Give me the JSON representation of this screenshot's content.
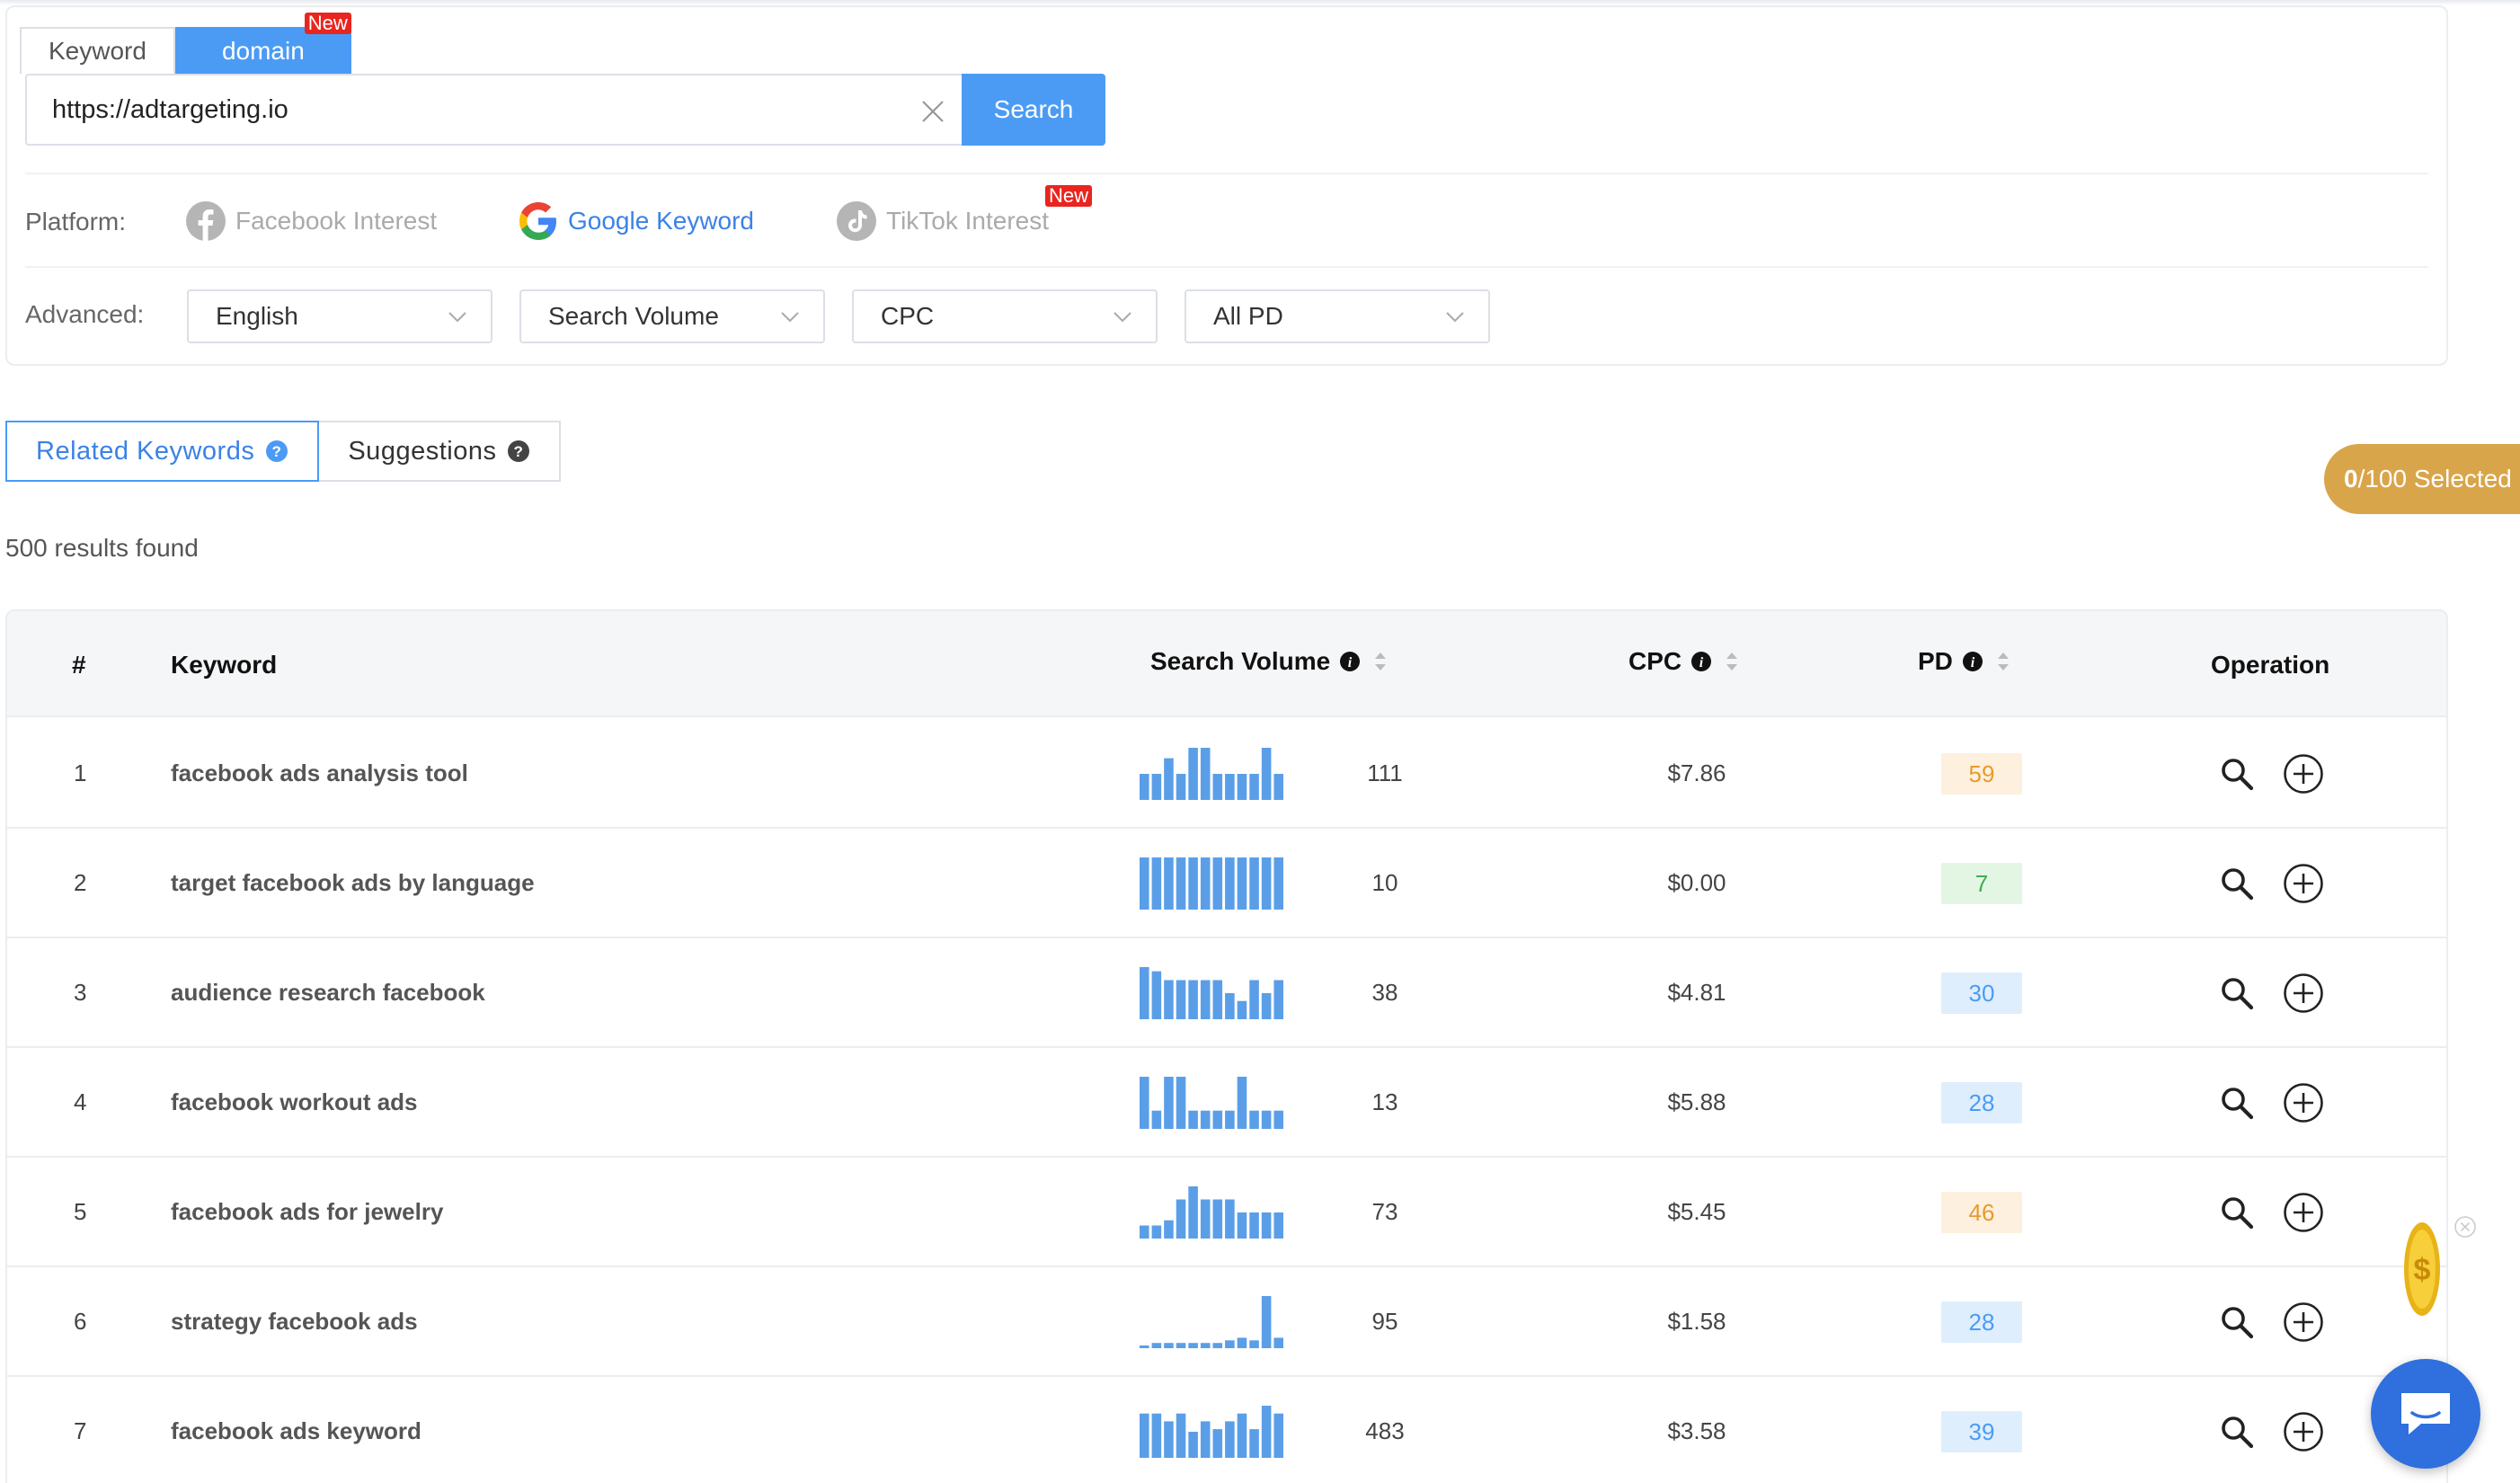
{
  "search_panel": {
    "mode_tabs": [
      {
        "label": "Keyword",
        "active": false
      },
      {
        "label": "domain",
        "active": true,
        "badge": "New"
      }
    ],
    "url_value": "https://adtargeting.io",
    "search_label": "Search",
    "platform_label": "Platform:",
    "platforms": [
      {
        "label": "Facebook Interest",
        "icon": "facebook-icon",
        "active": false
      },
      {
        "label": "Google Keyword",
        "icon": "google-icon",
        "active": true
      },
      {
        "label": "TikTok Interest",
        "icon": "tiktok-icon",
        "active": false,
        "badge": "New"
      }
    ],
    "advanced_label": "Advanced:",
    "filters": {
      "language": "English",
      "search_volume": "Search Volume",
      "cpc": "CPC",
      "pd": "All PD"
    }
  },
  "result_tabs": [
    {
      "label": "Related Keywords",
      "active": true
    },
    {
      "label": "Suggestions",
      "active": false
    }
  ],
  "selected": {
    "count": "0",
    "rest": "/100 Selected"
  },
  "results_found": "500 results found",
  "table": {
    "headers": {
      "index": "#",
      "keyword": "Keyword",
      "search_volume": "Search Volume",
      "cpc": "CPC",
      "pd": "PD",
      "operation": "Operation"
    },
    "rows": [
      {
        "index": "1",
        "keyword": "facebook ads analysis tool",
        "volume": "111",
        "cpc": "$7.86",
        "pd": "59",
        "pd_level": "medium",
        "trend": [
          0.5,
          0.5,
          0.8,
          0.5,
          1.0,
          1.0,
          0.5,
          0.5,
          0.5,
          0.5,
          1.0,
          0.5
        ]
      },
      {
        "index": "2",
        "keyword": "target facebook ads by language",
        "volume": "10",
        "cpc": "$0.00",
        "pd": "7",
        "pd_level": "easy",
        "trend": [
          1,
          1,
          1,
          1,
          1,
          1,
          1,
          1,
          1,
          1,
          1,
          1
        ]
      },
      {
        "index": "3",
        "keyword": "audience research facebook",
        "volume": "38",
        "cpc": "$4.81",
        "pd": "30",
        "pd_level": "low",
        "trend": [
          1.0,
          0.92,
          0.75,
          0.75,
          0.75,
          0.75,
          0.75,
          0.5,
          0.35,
          0.75,
          0.5,
          0.75
        ]
      },
      {
        "index": "4",
        "keyword": "facebook workout ads",
        "volume": "13",
        "cpc": "$5.88",
        "pd": "28",
        "pd_level": "low",
        "trend": [
          1.0,
          0.35,
          1.0,
          1.0,
          0.35,
          0.35,
          0.35,
          0.35,
          1.0,
          0.35,
          0.35,
          0.35
        ]
      },
      {
        "index": "5",
        "keyword": "facebook ads for jewelry",
        "volume": "73",
        "cpc": "$5.45",
        "pd": "46",
        "pd_level": "medium",
        "trend": [
          0.25,
          0.25,
          0.35,
          0.75,
          1.0,
          0.75,
          0.75,
          0.75,
          0.5,
          0.5,
          0.5,
          0.5
        ]
      },
      {
        "index": "6",
        "keyword": "strategy facebook ads",
        "volume": "95",
        "cpc": "$1.58",
        "pd": "28",
        "pd_level": "low",
        "trend": [
          0.05,
          0.1,
          0.1,
          0.1,
          0.1,
          0.1,
          0.1,
          0.15,
          0.2,
          0.15,
          1.0,
          0.2
        ]
      },
      {
        "index": "7",
        "keyword": "facebook ads keyword",
        "volume": "483",
        "cpc": "$3.58",
        "pd": "39",
        "pd_level": "low",
        "trend": [
          0.85,
          0.85,
          0.7,
          0.85,
          0.5,
          0.7,
          0.55,
          0.7,
          0.85,
          0.55,
          1.0,
          0.85
        ]
      }
    ]
  },
  "colors": {
    "accent": "#4b9bf5",
    "pd_medium_bg": "#fdf0de",
    "pd_medium_fg": "#e89a2e",
    "pd_easy_bg": "#e3f6e3",
    "pd_easy_fg": "#3fae4f",
    "pd_low_bg": "#dfeefc",
    "pd_low_fg": "#4b9bf5",
    "bars": "#5b9ee8",
    "selected_pill": "#d9a54a",
    "new_badge": "#e8251f"
  }
}
